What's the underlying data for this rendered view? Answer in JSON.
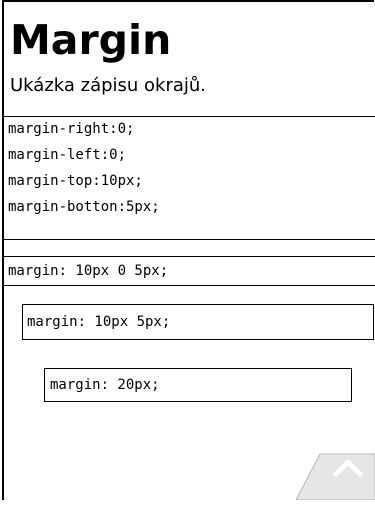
{
  "page": {
    "title": "Margin",
    "subtitle": "Ukázka zápisu okrajů."
  },
  "examples": {
    "individual": {
      "lines": [
        "margin-right:0;",
        "margin-left:0;",
        "margin-top:10px;",
        "margin-botton:5px;"
      ]
    },
    "shorthand_three": "margin: 10px 0 5px;",
    "shorthand_two": "margin: 10px 5px;",
    "shorthand_one": "margin: 20px;"
  },
  "controls": {
    "scroll_top_icon": "chevron-up-icon"
  }
}
